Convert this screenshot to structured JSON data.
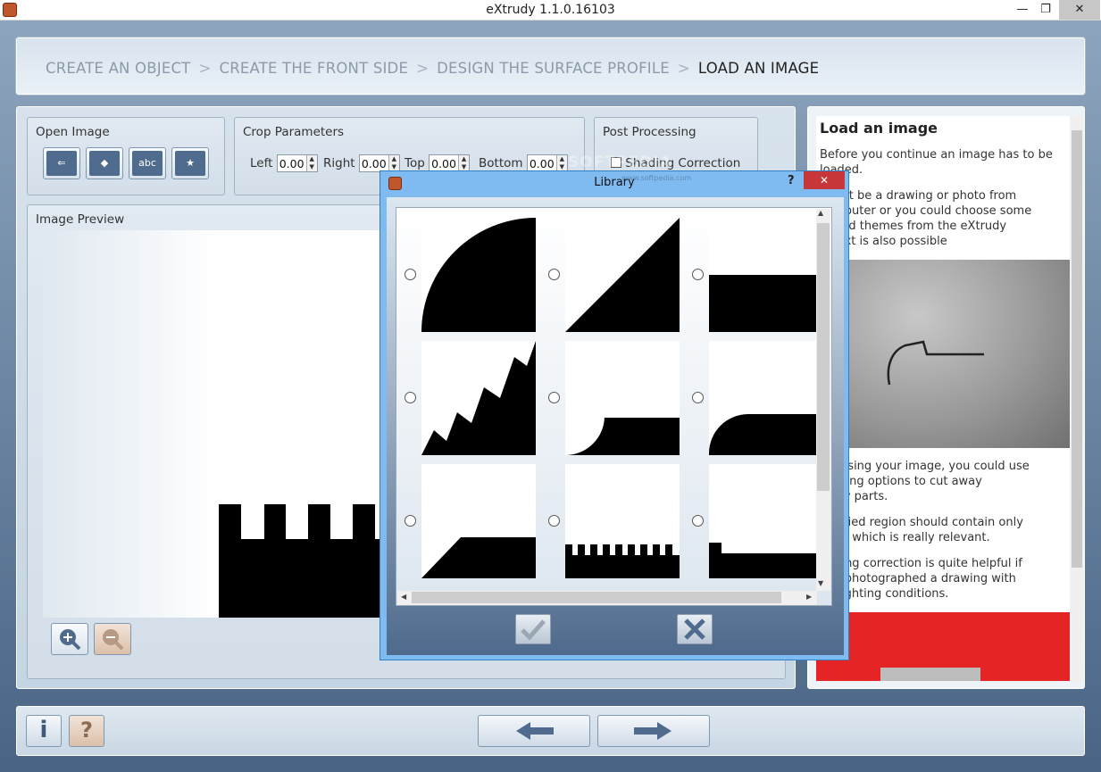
{
  "window": {
    "title": "eXtrudy 1.1.0.16103",
    "minimize": "—",
    "restore": "❐",
    "close": "✕"
  },
  "breadcrumb": {
    "steps": [
      "CREATE AN OBJECT",
      "CREATE THE FRONT SIDE",
      "DESIGN THE SURFACE PROFILE",
      "LOAD AN IMAGE"
    ],
    "separator": ">"
  },
  "open_image": {
    "label": "Open Image",
    "tools": [
      {
        "name": "open-file-icon",
        "glyph": "⇐"
      },
      {
        "name": "shapes-icon",
        "glyph": "◆"
      },
      {
        "name": "text-icon",
        "glyph": "abc"
      },
      {
        "name": "bookmark-icon",
        "glyph": "★"
      }
    ]
  },
  "crop": {
    "label": "Crop Parameters",
    "left_label": "Left",
    "left_value": "0.00",
    "right_label": "Right",
    "right_value": "0.00",
    "top_label": "Top",
    "top_value": "0.00",
    "bottom_label": "Bottom",
    "bottom_value": "0.00"
  },
  "post": {
    "label": "Post Processing",
    "shading_label": "Shading Correction",
    "shading_checked": false
  },
  "preview": {
    "label": "Image Preview"
  },
  "zoom": {
    "in_icon": "zoom-in-icon",
    "out_icon": "zoom-out-icon"
  },
  "help": {
    "title": "Load an image",
    "p1": "Before you continue an image has to be loaded.",
    "p2a": "might be a drawing or photo from",
    "p2b": "computer or you could choose some",
    "p2c": "efined themes from the eXtrudy",
    "p2d": "y. Text is also possible",
    "p3a": "choosing your image, you could use",
    "p3b": "ropping options to cut away",
    "p3c": "ssary parts.",
    "p4a": "pecified region should contain only",
    "p4b": "bject which is really relevant.",
    "p5a": "hading correction is quite helpful if",
    "p5b": "ave photographed a drawing with",
    "p5c": "en lighting conditions."
  },
  "library": {
    "title": "Library",
    "help": "?",
    "close": "✕",
    "watermark": "SOFTPEDIA",
    "watermark_sub": "www.softpedia.com",
    "ok_icon": "check-icon",
    "cancel_icon": "x-icon"
  },
  "bottom": {
    "info_label": "i",
    "help_label": "?",
    "back_icon": "arrow-left-icon",
    "next_icon": "arrow-right-icon"
  }
}
